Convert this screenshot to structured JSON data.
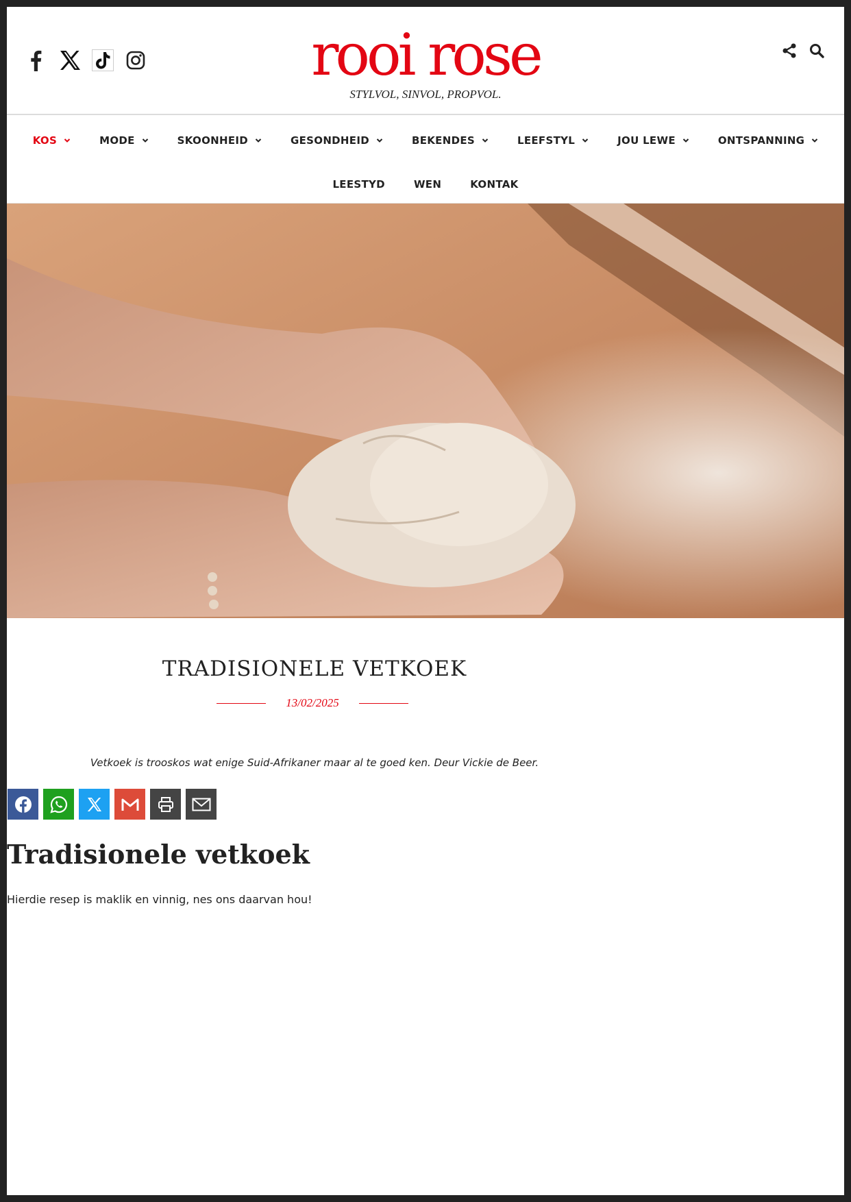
{
  "site": {
    "logo_text": "rooi rose",
    "tagline": "STYLVOL, SINVOL, PROPVOL."
  },
  "header": {
    "social_icons": [
      "facebook-icon",
      "x-icon",
      "tiktok-icon",
      "instagram-icon"
    ],
    "tool_icons": [
      "share-icon",
      "search-icon"
    ]
  },
  "nav": {
    "row1": [
      {
        "label": "KOS",
        "active": true
      },
      {
        "label": "MODE"
      },
      {
        "label": "SKOONHEID"
      },
      {
        "label": "GESONDHEID"
      },
      {
        "label": "BEKENDES"
      },
      {
        "label": "LEEFSTYL"
      },
      {
        "label": "JOU LEWE"
      },
      {
        "label": "ONTSPANNING"
      }
    ],
    "row2": [
      {
        "label": "LEESTYD"
      },
      {
        "label": "WEN"
      },
      {
        "label": "KONTAK"
      }
    ]
  },
  "article": {
    "title": "TRADISIONELE VETKOEK",
    "date": "13/02/2025",
    "intro": "Vetkoek is trooskos wat enige Suid-Afrikaner maar al te goed ken. Deur Vickie de Beer.",
    "heading": "Tradisionele vetkoek",
    "paragraph": "Hierdie resep is maklik en vinnig, nes ons daarvan hou!"
  },
  "share_buttons": [
    {
      "icon": "facebook-icon",
      "color": "#3b5998"
    },
    {
      "icon": "whatsapp-icon",
      "color": "#1fa01f"
    },
    {
      "icon": "x-icon",
      "color": "#1da1f2"
    },
    {
      "icon": "gmail-icon",
      "color": "#dd4b39"
    },
    {
      "icon": "print-icon",
      "color": "#444444"
    },
    {
      "icon": "email-icon",
      "color": "#444444"
    }
  ],
  "colors": {
    "brand_red": "#e30613",
    "text_dark": "#222222"
  }
}
